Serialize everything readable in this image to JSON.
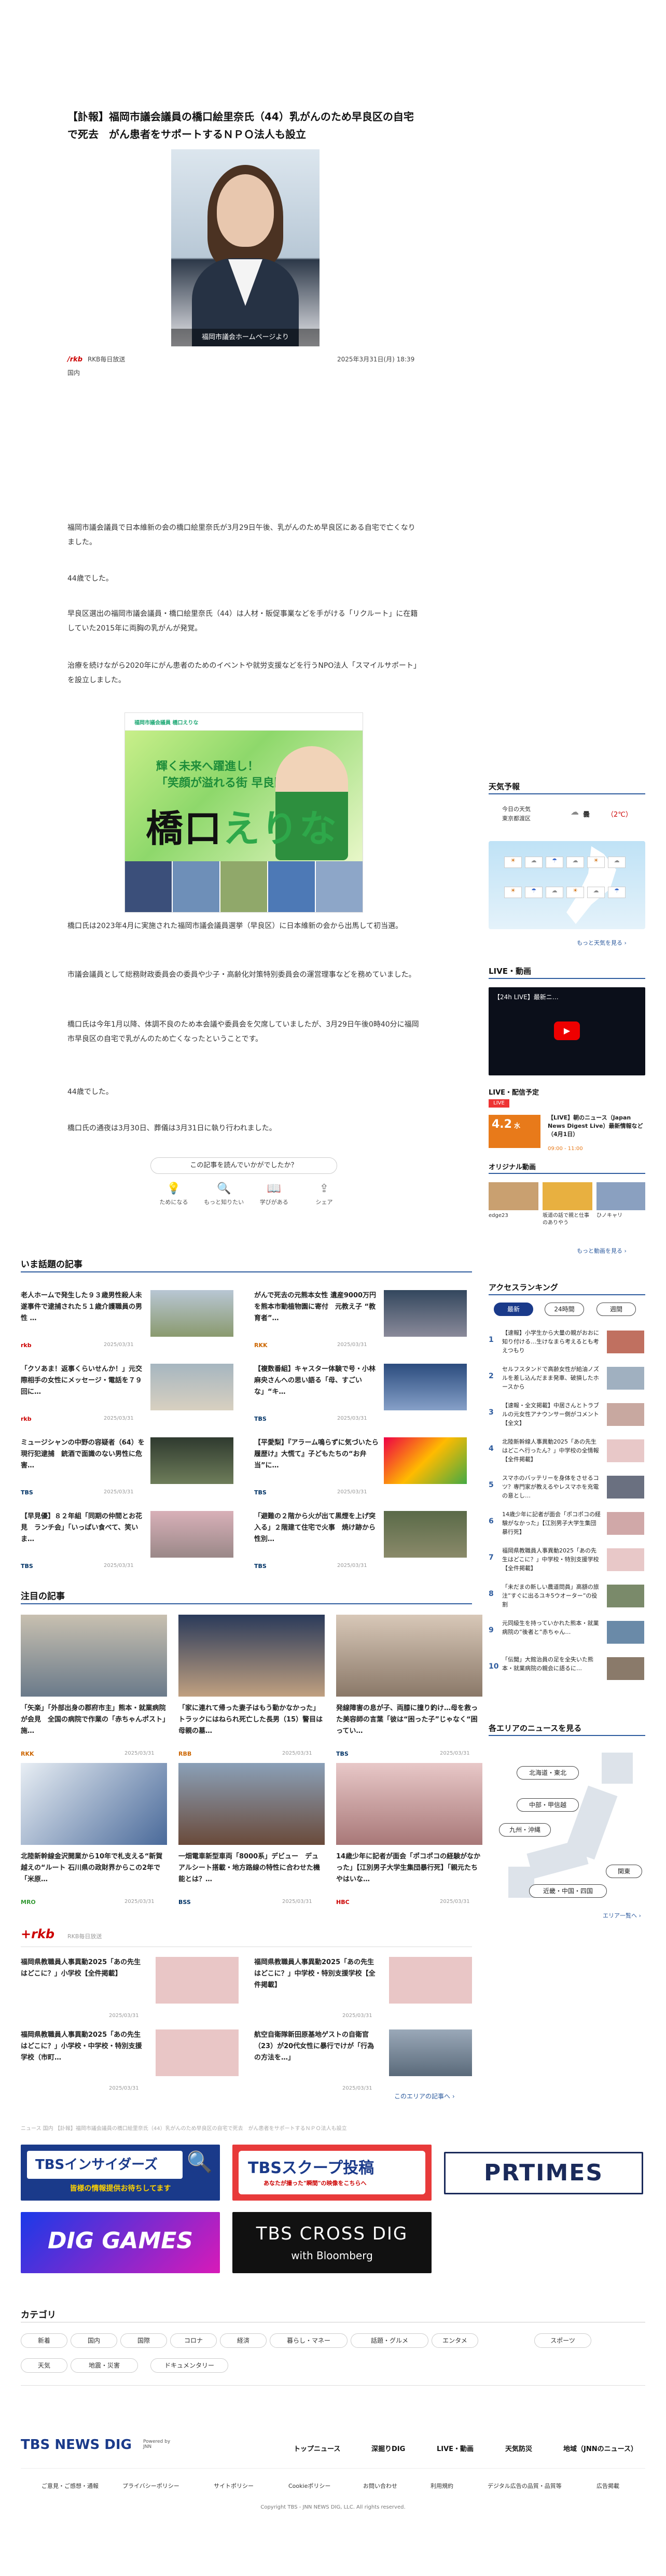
{
  "article": {
    "title": "【訃報】福岡市議会議員の橋口絵里奈氏（44）乳がんのため早良区の自宅で死去　がん患者をサポートするＮＰＯ法人も設立",
    "hero_caption": "福岡市議会ホームページより",
    "source_logo": "rkb",
    "source_name": "RKB毎日放送",
    "datetime": "2025年3月31日(月) 18:39",
    "tag": "国内",
    "paragraphs": [
      "福岡市議会議員で日本維新の会の橋口絵里奈氏が3月29日午後、乳がんのため早良区にある自宅で亡くなりました。",
      "44歳でした。",
      "早良区選出の福岡市議会議員・橋口絵里奈氏（44）は人材・販促事業などを手がける「リクルート」に在籍していた2015年に両胸の乳がんが発覚。",
      "治療を続けながら2020年にがん患者のためのイベントや就労支援などを行うNPO法人「スマイルサポート」を設立しました。"
    ],
    "paragraphs2": [
      "橋口氏は2023年4月に実施された福岡市議会議員選挙（早良区）に日本維新の会から出馬して初当選。",
      "市議会議員として総務財政委員会の委員や少子・高齢化対策特別委員会の運営理事などを務めていました。",
      "橋口氏は今年1月以降、体調不良のため本会議や委員会を欠席していましたが、3月29日午後0時40分に福岡市早良区の自宅で乳がんのため亡くなったということです。",
      "44歳でした。",
      "橋口氏の通夜は3月30日、葬儀は3月31日に執り行われました。"
    ],
    "banner": {
      "header_name": "福岡市議会議員 橋口えりな",
      "slogan_line1": "輝く未来へ躍進し！",
      "slogan_line2": "「笑顔が溢れる街 早良区」へ",
      "name_black": "橋口",
      "name_green": "えりな"
    }
  },
  "feedback": {
    "question": "この記事を読んでいかがでしたか？",
    "options": [
      "ためになる",
      "もっと知りたい",
      "学びがある",
      "シェア"
    ]
  },
  "trending": {
    "title": "いま話題の記事",
    "items": [
      {
        "title": "老人ホームで発生した９３歳男性殺人未遂事件で逮捕された５１歳介護職員の男性 …",
        "source": "rkb",
        "date": "2025/03/31"
      },
      {
        "title": "がんで死去の元熊本女性 遺産9000万円を熊本市動植物園に寄付　元教え子 “教育者”…",
        "source": "RKK",
        "date": "2025/03/31"
      },
      {
        "title": "「クソあま！返事くらいせんか！」元交際相手の女性にメッセージ・電話を７９回に…",
        "source": "rkb",
        "date": "2025/03/31"
      },
      {
        "title": "【複数番組】キャスター体験で号・小林麻央さんへの思い語る「母、すごいな」“キ…",
        "source": "TBS",
        "date": "2025/03/31"
      },
      {
        "title": "ミュージシャンの中野の容疑者（64）を現行犯逮捕　銃酒で面識のない男性に危害…",
        "source": "TBS",
        "date": "2025/03/31"
      },
      {
        "title": "【平愛梨】『アラーム鳴らずに気づいたら履歴け』大慌て』子どもたちの“お弁当”に…",
        "source": "TBS",
        "date": "2025/03/31"
      },
      {
        "title": "【早見優】８２年組「同期の仲間とお花見　ランチ会」「いっぱい食べて、笑いま…",
        "source": "TBS",
        "date": "2025/03/31"
      },
      {
        "title": "「避難の２階から火が出て黒煙を上げ突入る」２階建て住宅で火事　焼け跡から性別…",
        "source": "TBS",
        "date": "2025/03/31"
      }
    ]
  },
  "featured": {
    "title": "注目の記事",
    "items": [
      {
        "title": "「矢楽」「外部出身の郡府市主」熊本・就業病院が会見　全国の病院で作業の「赤ちゃんポスト」施…",
        "source": "RKK",
        "date": "2025/03/31"
      },
      {
        "title": "「家に連れて帰った妻子はもう動かなかった」トラックにはねられ死亡した長男（15）警目は母親の墓…",
        "source": "RBB",
        "date": "2025/03/31"
      },
      {
        "title": "発線障害の息が子、両膝に撞り釣け…母を救った美容師の言葉「彼は“困った子”じゃなく“困ってい…",
        "source": "TBS",
        "date": "2025/03/31"
      },
      {
        "title": "北陸新幹線金沢開業から10年で札支える“新賀越えの“ルート 石川県の政財界からこの2年で「米原…",
        "source": "MRO",
        "date": "2025/03/31"
      },
      {
        "title": "一畑電車新型車両「8000系」デビュー　デュアルシート搭載・地方路線の特性に合わせた機能とは？…",
        "source": "BSS",
        "date": "2025/03/31"
      },
      {
        "title": "14歳少年に記者が面会「ポコポコの経験がなかった」【江別男子大学生集団暴行死】「親元たちやはいな…",
        "source": "HBC",
        "date": "2025/03/31"
      }
    ]
  },
  "rkb_section": {
    "label": "RKB毎日放送",
    "items": [
      {
        "title": "福岡県教職員人事異動2025「あの先生はどこに？」小学校【全件掲載】",
        "date": "2025/03/31"
      },
      {
        "title": "福岡県教職員人事異動2025「あの先生はどこに？」中学校・特別支援学校【全件掲載】",
        "date": "2025/03/31"
      },
      {
        "title": "福岡県教職員人事異動2025「あの先生はどこに？」小学校・中学校・特別支援学校（市町…",
        "date": "2025/03/31"
      },
      {
        "title": "航空自衛隊新田原基地ゲストの自衛官（23）が20代女性に暴行でけが「行為の方法を…」",
        "date": "2025/03/31"
      }
    ],
    "more": "このエリアの記事へ ›"
  },
  "breadcrumb_note": "ニュース 国内 【訃報】福岡市議会議員の橋口絵里奈氏（44）乳がんのため早良区の自宅で死去　がん患者をサポートするＮＰＯ法人も設立",
  "ads": {
    "insiders": "TBSインサイダーズ",
    "insiders_sub": "皆様の情報提供お待ちしてます",
    "scoop": "TBSスクープ投稿",
    "scoop_sub": "あなたが撮った\"瞬間\"の映像をこちらへ",
    "prtimes": "PRTIMES",
    "diggames": "DIG GAMES",
    "crossdig": "TBS CROSS DIG",
    "crossdig_sub": "with Bloomberg"
  },
  "categories": {
    "title": "カテゴリ",
    "items": [
      "新着",
      "国内",
      "国際",
      "コロナ",
      "経済",
      "暮らし・マネー",
      "話題・グルメ",
      "エンタメ",
      "スポーツ",
      "天気",
      "地震・災害",
      "ドキュメンタリー"
    ]
  },
  "sidebar": {
    "weather": {
      "title": "天気予報",
      "label_today": "今日の天気",
      "label_area": "東京都渡区",
      "status": "曇",
      "temp": "（2℃）",
      "more": "もっと天気を見る ›"
    },
    "live": {
      "title": "LIVE・動画",
      "video_title": "【24h LIVE】最新ニ…",
      "schedule_title": "LIVE・配信予定",
      "badge": "LIVE",
      "live_text": "【LIVE】朝のニュース（Japan News Digest Live）最新情報など（4月1日）",
      "date": "4.2",
      "weekday": "水",
      "time": "09:00 - 11:00",
      "original_title": "オリジナル動画",
      "original_items": [
        "edge23",
        "坂道の話で親と仕事のありやう",
        "ひノキャリ"
      ],
      "more": "もっと動画を見る ›"
    },
    "ranking": {
      "title": "アクセスランキング",
      "tabs": [
        "最新",
        "24時間",
        "週間"
      ],
      "items": [
        {
          "n": "1",
          "title": "【速報】小学生から大量の親がおおに知り付ける…生けなまら考えるとも考えつもり"
        },
        {
          "n": "2",
          "title": "セルフスタンドで高齢女性が給油ノズルを差し込んだまま発車、破損したホースから"
        },
        {
          "n": "3",
          "title": "【速報・全文掲載】中居さんとトラブルの元女性アナウンサー側がコメント【全文】"
        },
        {
          "n": "4",
          "title": "北陸新幹線人事異動2025「あの先生はどこへ行ったん？」中学校の全情報【全件掲載】"
        },
        {
          "n": "5",
          "title": "スマホのバッテリーを身体をさせるコツ？専門家が教えるやレスマホを充電の意とし…"
        },
        {
          "n": "6",
          "title": "14歳少年に記者が面会「ポコポコの経験がなかった」【江別男子大学生集団暴行死】"
        },
        {
          "n": "7",
          "title": "福岡県教職員人事異動2025「あの先生はどこに？」中学校・特別支援学校【全件掲載】"
        },
        {
          "n": "8",
          "title": "「未だまの新しい農道問員」高額の旅注”すぐに出るユキ5ウオーター”の役割"
        },
        {
          "n": "9",
          "title": "元同級生を持っていかれた熊本・就業病院の”後者と”赤ちゃん…"
        },
        {
          "n": "10",
          "title": "「伝聞」大館治員の足を全失いた熊本・就業病院の親会に語るに…"
        }
      ]
    },
    "area": {
      "title": "各エリアのニュースを見る",
      "regions": [
        "北海道・東北",
        "中部・甲信越",
        "九州・沖縄",
        "関東",
        "近畿・中国・四国"
      ],
      "more": "エリア一覧へ ›"
    }
  },
  "footer": {
    "logo": "TBS NEWS DIG",
    "logo_sub": "Powered by JNN",
    "nav": [
      "トップニュース",
      "深掘りDIG",
      "LIVE・動画",
      "天気防災",
      "地域（JNNのニュース）"
    ],
    "links": [
      "ご意見・ご感想・通報",
      "プライバシーポリシー",
      "サイトポリシー",
      "Cookieポリシー",
      "お問い合わせ",
      "利用規約",
      "デジタル広告の品質・品質等",
      "広告掲載"
    ],
    "copyright": "Copyright TBS - JNN NEWS DIG, LLC. All rights reserved."
  }
}
